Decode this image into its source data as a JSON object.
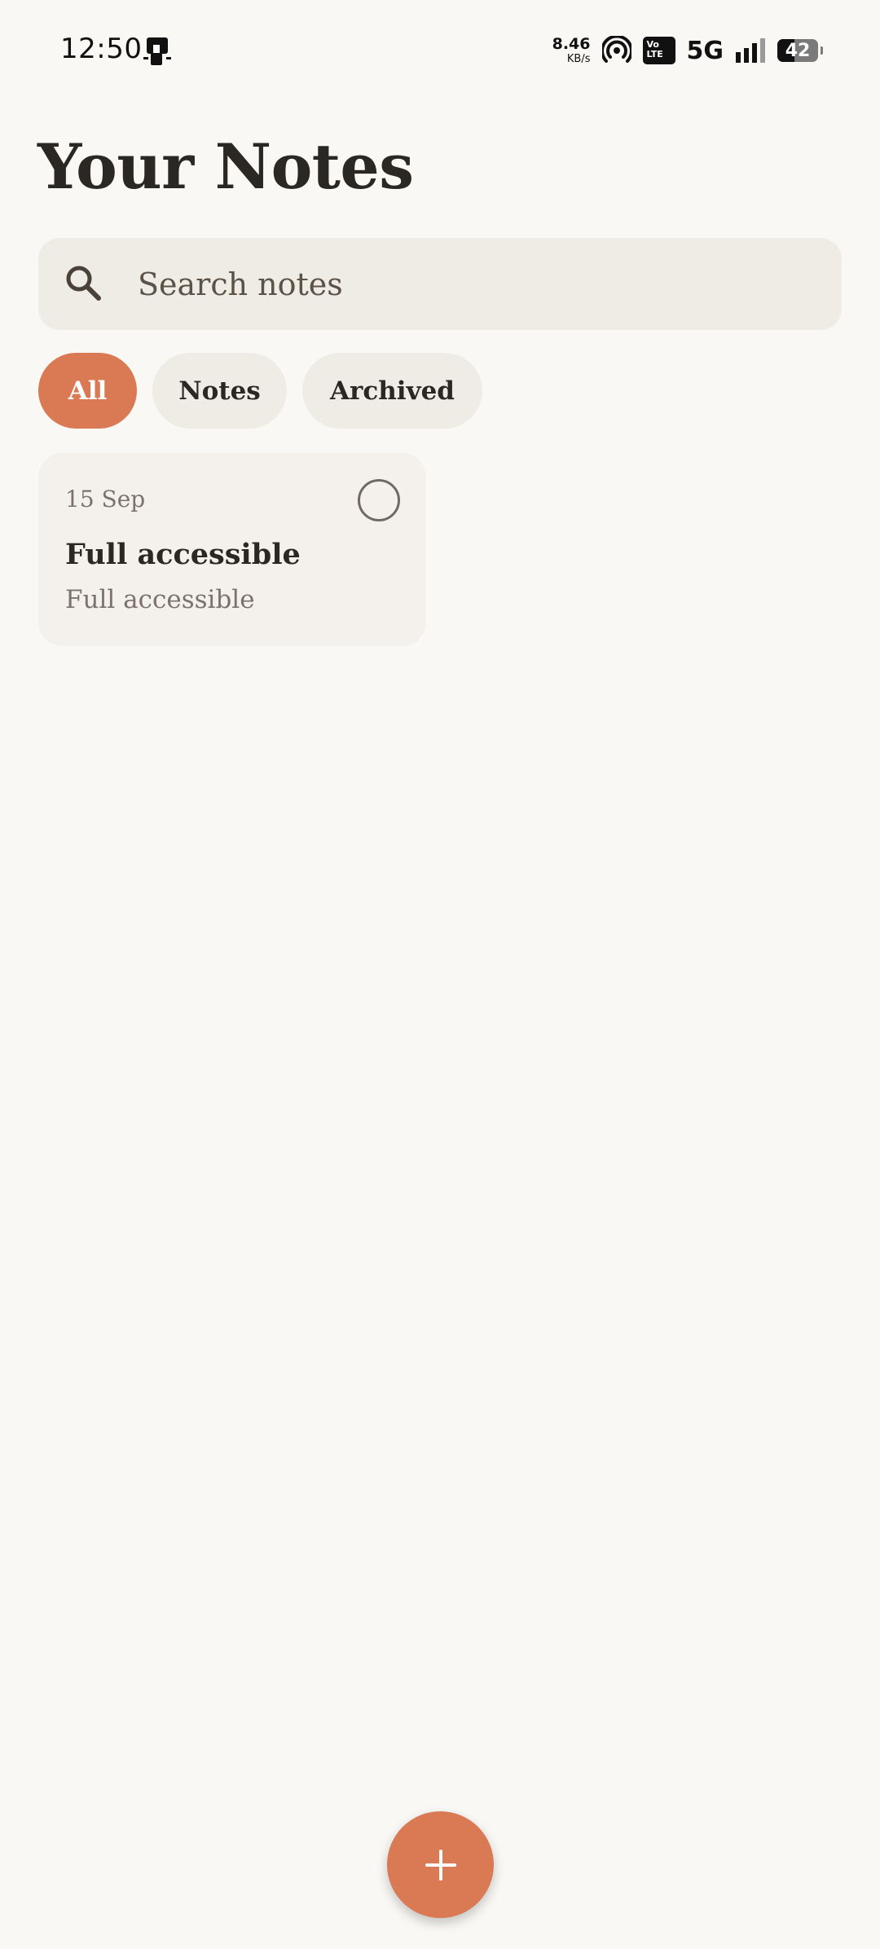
{
  "status_bar": {
    "time": "12:50",
    "net_speed_value": "8.46",
    "net_speed_unit": "KB/s",
    "volte_label_top": "Vo",
    "volte_label_bottom": "LTE",
    "network_type": "5G",
    "battery_level": "42",
    "battery_fraction": 0.42,
    "icons": [
      "notification-app-icon",
      "hotspot-icon",
      "volte-icon",
      "signal-icon",
      "battery-icon"
    ]
  },
  "header": {
    "title": "Your Notes"
  },
  "search": {
    "placeholder": "Search notes",
    "value": "",
    "icon": "search-icon"
  },
  "filters": {
    "selected": "All",
    "items": [
      {
        "label": "All"
      },
      {
        "label": "Notes"
      },
      {
        "label": "Archived"
      }
    ]
  },
  "notes": [
    {
      "date": "15 Sep",
      "title": "Full accessible",
      "preview": "Full accessible",
      "selected": false
    }
  ],
  "fab": {
    "icon": "plus-icon"
  },
  "colors": {
    "background": "#f9f8f5",
    "accent": "#d97a55",
    "surface": "#efebe5",
    "card": "#f4f0eb",
    "text_primary": "#2b2823",
    "text_secondary": "#7b736b"
  }
}
